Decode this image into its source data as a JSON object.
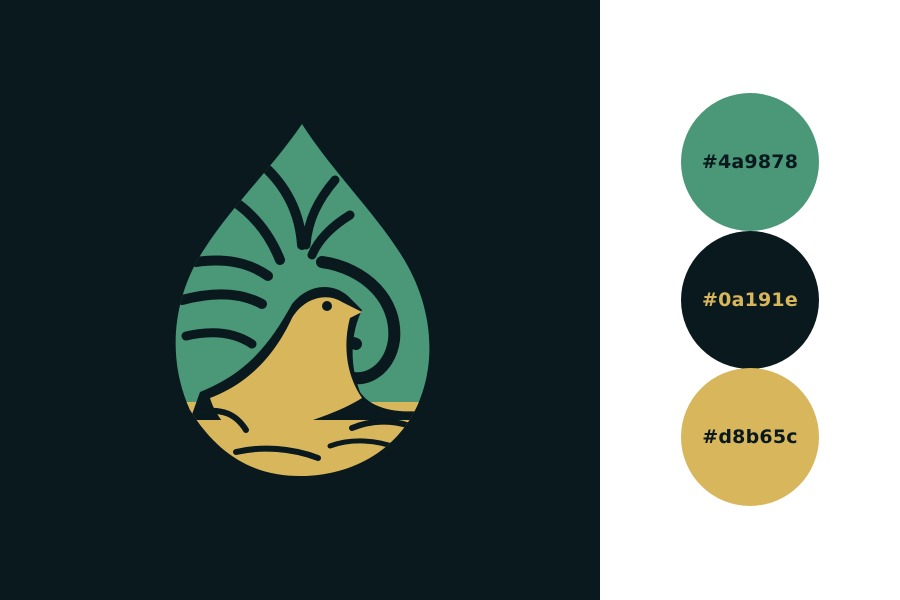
{
  "brand": {
    "logo_icon": "water-drop-bird-icon",
    "background": "#0a191e",
    "primary": "#4a9878",
    "accent": "#d8b65c"
  },
  "palette": [
    {
      "label": "#4a9878",
      "fill": "#4a9878",
      "text_color": "#0a191e"
    },
    {
      "label": "#0a191e",
      "fill": "#0a191e",
      "text_color": "#d8b65c"
    },
    {
      "label": "#d8b65c",
      "fill": "#d8b65c",
      "text_color": "#0a191e"
    }
  ]
}
